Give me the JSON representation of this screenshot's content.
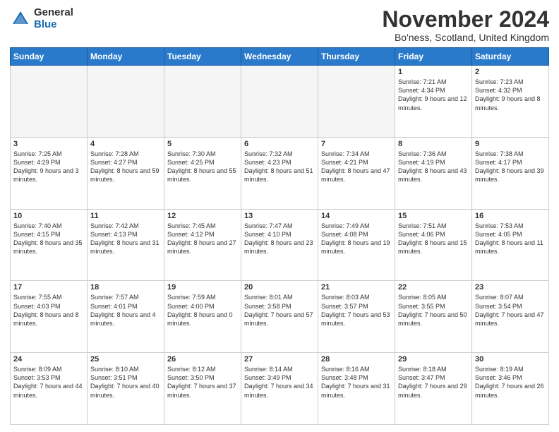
{
  "logo": {
    "general": "General",
    "blue": "Blue"
  },
  "title": "November 2024",
  "location": "Bo'ness, Scotland, United Kingdom",
  "days_of_week": [
    "Sunday",
    "Monday",
    "Tuesday",
    "Wednesday",
    "Thursday",
    "Friday",
    "Saturday"
  ],
  "weeks": [
    [
      {
        "day": "",
        "empty": true
      },
      {
        "day": "",
        "empty": true
      },
      {
        "day": "",
        "empty": true
      },
      {
        "day": "",
        "empty": true
      },
      {
        "day": "",
        "empty": true
      },
      {
        "day": "1",
        "info": "Sunrise: 7:21 AM\nSunset: 4:34 PM\nDaylight: 9 hours and 12 minutes."
      },
      {
        "day": "2",
        "info": "Sunrise: 7:23 AM\nSunset: 4:32 PM\nDaylight: 9 hours and 8 minutes."
      }
    ],
    [
      {
        "day": "3",
        "info": "Sunrise: 7:25 AM\nSunset: 4:29 PM\nDaylight: 9 hours and 3 minutes."
      },
      {
        "day": "4",
        "info": "Sunrise: 7:28 AM\nSunset: 4:27 PM\nDaylight: 8 hours and 59 minutes."
      },
      {
        "day": "5",
        "info": "Sunrise: 7:30 AM\nSunset: 4:25 PM\nDaylight: 8 hours and 55 minutes."
      },
      {
        "day": "6",
        "info": "Sunrise: 7:32 AM\nSunset: 4:23 PM\nDaylight: 8 hours and 51 minutes."
      },
      {
        "day": "7",
        "info": "Sunrise: 7:34 AM\nSunset: 4:21 PM\nDaylight: 8 hours and 47 minutes."
      },
      {
        "day": "8",
        "info": "Sunrise: 7:36 AM\nSunset: 4:19 PM\nDaylight: 8 hours and 43 minutes."
      },
      {
        "day": "9",
        "info": "Sunrise: 7:38 AM\nSunset: 4:17 PM\nDaylight: 8 hours and 39 minutes."
      }
    ],
    [
      {
        "day": "10",
        "info": "Sunrise: 7:40 AM\nSunset: 4:15 PM\nDaylight: 8 hours and 35 minutes."
      },
      {
        "day": "11",
        "info": "Sunrise: 7:42 AM\nSunset: 4:13 PM\nDaylight: 8 hours and 31 minutes."
      },
      {
        "day": "12",
        "info": "Sunrise: 7:45 AM\nSunset: 4:12 PM\nDaylight: 8 hours and 27 minutes."
      },
      {
        "day": "13",
        "info": "Sunrise: 7:47 AM\nSunset: 4:10 PM\nDaylight: 8 hours and 23 minutes."
      },
      {
        "day": "14",
        "info": "Sunrise: 7:49 AM\nSunset: 4:08 PM\nDaylight: 8 hours and 19 minutes."
      },
      {
        "day": "15",
        "info": "Sunrise: 7:51 AM\nSunset: 4:06 PM\nDaylight: 8 hours and 15 minutes."
      },
      {
        "day": "16",
        "info": "Sunrise: 7:53 AM\nSunset: 4:05 PM\nDaylight: 8 hours and 11 minutes."
      }
    ],
    [
      {
        "day": "17",
        "info": "Sunrise: 7:55 AM\nSunset: 4:03 PM\nDaylight: 8 hours and 8 minutes."
      },
      {
        "day": "18",
        "info": "Sunrise: 7:57 AM\nSunset: 4:01 PM\nDaylight: 8 hours and 4 minutes."
      },
      {
        "day": "19",
        "info": "Sunrise: 7:59 AM\nSunset: 4:00 PM\nDaylight: 8 hours and 0 minutes."
      },
      {
        "day": "20",
        "info": "Sunrise: 8:01 AM\nSunset: 3:58 PM\nDaylight: 7 hours and 57 minutes."
      },
      {
        "day": "21",
        "info": "Sunrise: 8:03 AM\nSunset: 3:57 PM\nDaylight: 7 hours and 53 minutes."
      },
      {
        "day": "22",
        "info": "Sunrise: 8:05 AM\nSunset: 3:55 PM\nDaylight: 7 hours and 50 minutes."
      },
      {
        "day": "23",
        "info": "Sunrise: 8:07 AM\nSunset: 3:54 PM\nDaylight: 7 hours and 47 minutes."
      }
    ],
    [
      {
        "day": "24",
        "info": "Sunrise: 8:09 AM\nSunset: 3:53 PM\nDaylight: 7 hours and 44 minutes."
      },
      {
        "day": "25",
        "info": "Sunrise: 8:10 AM\nSunset: 3:51 PM\nDaylight: 7 hours and 40 minutes."
      },
      {
        "day": "26",
        "info": "Sunrise: 8:12 AM\nSunset: 3:50 PM\nDaylight: 7 hours and 37 minutes."
      },
      {
        "day": "27",
        "info": "Sunrise: 8:14 AM\nSunset: 3:49 PM\nDaylight: 7 hours and 34 minutes."
      },
      {
        "day": "28",
        "info": "Sunrise: 8:16 AM\nSunset: 3:48 PM\nDaylight: 7 hours and 31 minutes."
      },
      {
        "day": "29",
        "info": "Sunrise: 8:18 AM\nSunset: 3:47 PM\nDaylight: 7 hours and 29 minutes."
      },
      {
        "day": "30",
        "info": "Sunrise: 8:19 AM\nSunset: 3:46 PM\nDaylight: 7 hours and 26 minutes."
      }
    ]
  ]
}
